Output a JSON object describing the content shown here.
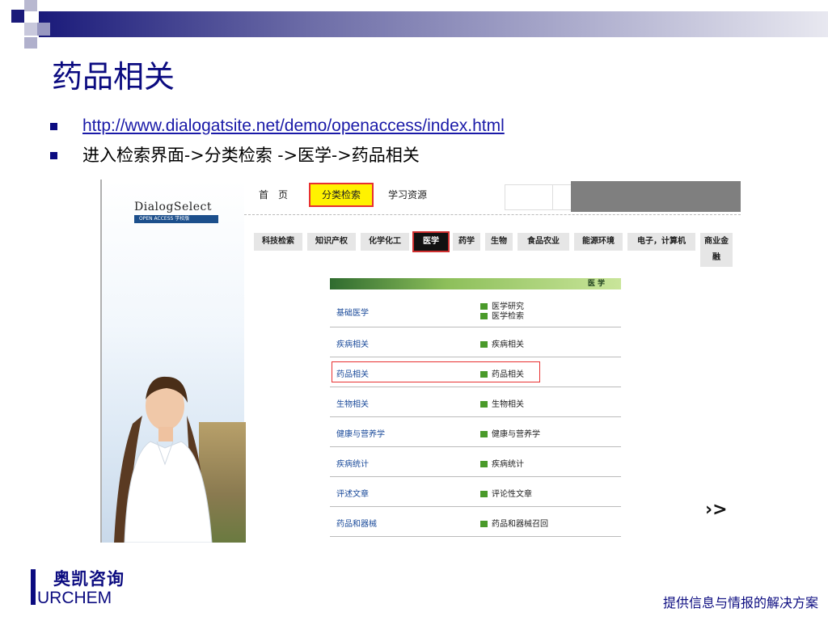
{
  "slide": {
    "title": "药品相关",
    "bullets": [
      "http://www.dialogatsite.net/demo/openaccess/index.html",
      "进入检索界面->分类检索 ->医学->药品相关"
    ],
    "footer_cn": "奥凯咨询",
    "footer_en": "URCHEM",
    "tagline": "提供信息与情报的解决方案"
  },
  "site": {
    "logo": "DialogSelect",
    "logo_sub": "OPEN ACCESS 学校版",
    "nav": {
      "home": "首页",
      "classified": "分类检索",
      "learning": "学习资源"
    },
    "categories": [
      {
        "label": "科技检索",
        "active": false
      },
      {
        "label": "知识产权",
        "active": false
      },
      {
        "label": "化学化工",
        "active": false
      },
      {
        "label": "医学",
        "active": true
      },
      {
        "label": "药学",
        "active": false
      },
      {
        "label": "生物",
        "active": false
      },
      {
        "label": "食品农业",
        "active": false
      },
      {
        "label": "能源环境",
        "active": false
      },
      {
        "label": "电子，计算机",
        "active": false
      },
      {
        "label": "商业金融",
        "active": false
      }
    ],
    "table_header": "医 学",
    "rows": [
      {
        "link": "基础医学",
        "subs": [
          "医学研究",
          "医学检索"
        ]
      },
      {
        "link": "疾病相关",
        "subs": [
          "疾病相关"
        ]
      },
      {
        "link": "药品相关",
        "subs": [
          "药品相关"
        ]
      },
      {
        "link": "生物相关",
        "subs": [
          "生物相关"
        ]
      },
      {
        "link": "健康与营养学",
        "subs": [
          "健康与营养学"
        ]
      },
      {
        "link": "疾病统计",
        "subs": [
          "疾病统计"
        ]
      },
      {
        "link": "评述文章",
        "subs": [
          "评论性文章"
        ]
      },
      {
        "link": "药品和器械",
        "subs": [
          "药品和器械召回"
        ]
      }
    ]
  },
  "colors": {
    "title": "#0b0b80",
    "highlight": "#e83030",
    "tab_active": "#fff200"
  }
}
